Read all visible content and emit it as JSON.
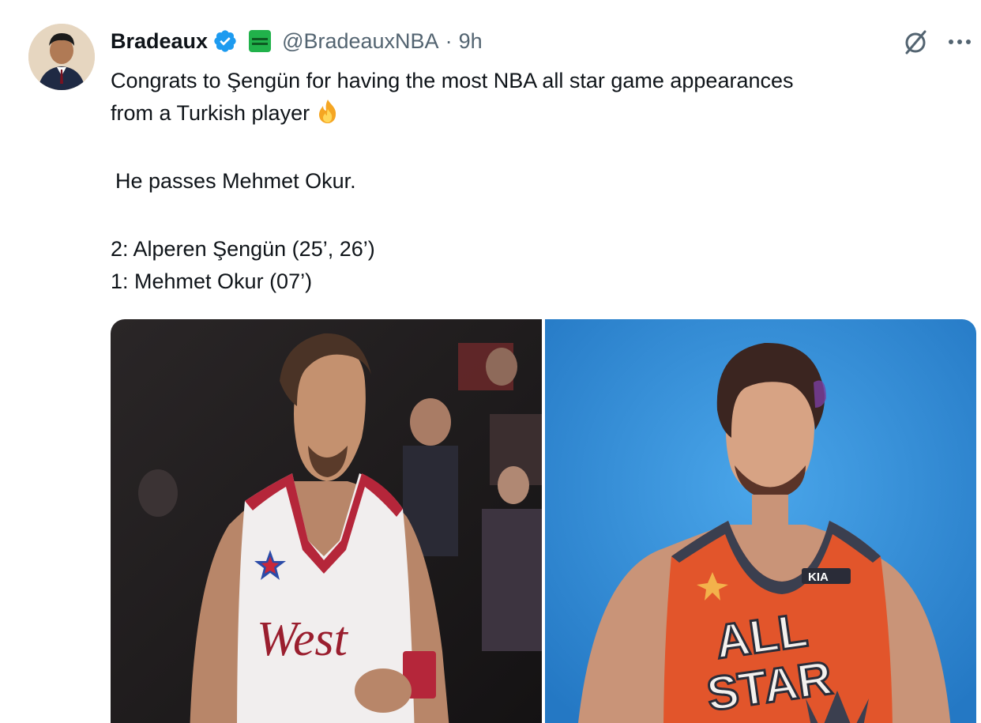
{
  "tweet": {
    "author": {
      "display_name": "Bradeaux",
      "verified": true,
      "affiliation_badge": "green-affiliate-badge",
      "handle": "@BradeauxNBA",
      "separator": "·",
      "time": "9h"
    },
    "lines": [
      "Congrats to Şengün for having the most NBA all star game appearances",
      "from a Turkish player",
      "He passes Mehmet Okur.",
      "2: Alperen Şengün (25’, 26’)",
      "1: Mehmet Okur (07’)"
    ],
    "emoji": "fire-emoji",
    "photo_left": {
      "jersey_text": "West",
      "subject": "player in white and red West all-star jersey"
    },
    "photo_right": {
      "jersey_line1": "ALL",
      "jersey_line2": "STAR",
      "sponsor": "KIA",
      "subject": "player in orange all-star jersey on blue background"
    }
  },
  "actions": {
    "grok_icon": "grok-icon",
    "more_icon": "more-icon"
  },
  "colors": {
    "text": "#0f1419",
    "secondary": "#536471",
    "verified_blue": "#1d9bf0",
    "left_bg": "#1e1c1d",
    "right_bg": "#2f8fd6",
    "jersey_orange": "#e2552b"
  }
}
